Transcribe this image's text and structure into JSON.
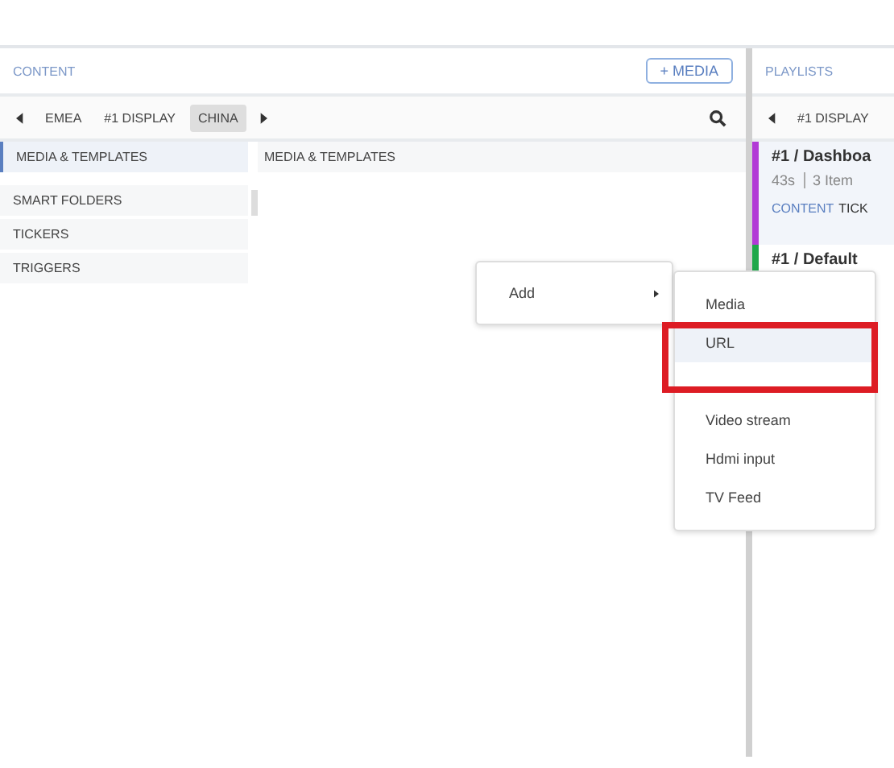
{
  "content": {
    "title": "CONTENT",
    "add_button": "+ MEDIA",
    "tabs": [
      {
        "label": "EMEA",
        "selected": false
      },
      {
        "label": "#1 DISPLAY",
        "selected": false
      },
      {
        "label": "CHINA",
        "selected": true
      }
    ],
    "sidebar": [
      {
        "label": "MEDIA & TEMPLATES",
        "selected": true
      },
      {
        "label": "SMART FOLDERS",
        "selected": false
      },
      {
        "label": "TICKERS",
        "selected": false
      },
      {
        "label": "TRIGGERS",
        "selected": false
      }
    ],
    "main_heading": "MEDIA & TEMPLATES"
  },
  "playlists": {
    "title": "PLAYLISTS",
    "tabs": [
      {
        "label": "#1 DISPLAY",
        "selected": false
      }
    ],
    "items": [
      {
        "name": "#1 / Dashboa",
        "duration": "43s",
        "count": "3 Item",
        "color": "#b23ad6",
        "tags": [
          "CONTENT",
          "TICK"
        ]
      },
      {
        "name": "#1 / Default",
        "color": "#1ea84a"
      }
    ]
  },
  "context_menu": {
    "items": [
      {
        "label": "Add",
        "submenu": true
      }
    ]
  },
  "submenu": {
    "items": [
      {
        "label": "Media",
        "selected": false
      },
      {
        "label": "URL",
        "selected": true
      },
      {
        "label": "Video stream",
        "selected": false
      },
      {
        "label": "Hdmi input",
        "selected": false
      },
      {
        "label": "TV Feed",
        "selected": false
      }
    ]
  }
}
